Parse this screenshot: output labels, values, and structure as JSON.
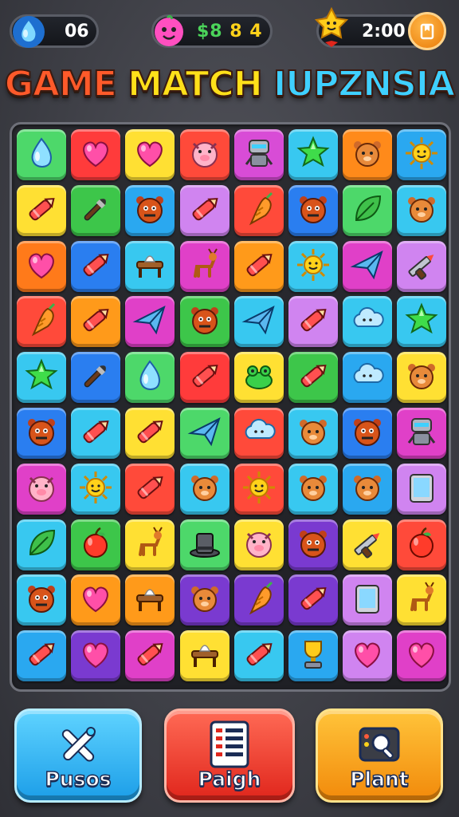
{
  "hud": {
    "lives": "06",
    "coins_a": "$8",
    "coins_b": "8 4",
    "timer": "2:00",
    "icons": {
      "lives": "water-drop-icon",
      "coins": "pink-face-icon",
      "timer_char": "star-character-icon",
      "timer_button": "book-icon"
    }
  },
  "title": {
    "part1": "GAME ",
    "part2": "MATCH ",
    "part3": "IUPZNSIA"
  },
  "board": {
    "rows": [
      [
        [
          "#4dd86a",
          "drop"
        ],
        [
          "#ff3b3b",
          "heart"
        ],
        [
          "#ffe033",
          "heart"
        ],
        [
          "#ff4a3a",
          "pig"
        ],
        [
          "#d84cd6",
          "robot"
        ],
        [
          "#38c8f0",
          "star"
        ],
        [
          "#ff8a1a",
          "bear"
        ],
        [
          "#2aa8f0",
          "sun"
        ]
      ],
      [
        [
          "#ffe033",
          "crayon"
        ],
        [
          "#3dc64a",
          "brush"
        ],
        [
          "#2aa8f0",
          "monster"
        ],
        [
          "#d084f0",
          "crayon"
        ],
        [
          "#ff4a3a",
          "carrot"
        ],
        [
          "#2a7ef0",
          "monster"
        ],
        [
          "#4dd86a",
          "leaf"
        ],
        [
          "#38c8f0",
          "bear"
        ]
      ],
      [
        [
          "#ff7a1a",
          "heart"
        ],
        [
          "#2a7ef0",
          "crayon"
        ],
        [
          "#38c8f0",
          "table"
        ],
        [
          "#e040c8",
          "deer"
        ],
        [
          "#ff9a1a",
          "crayon"
        ],
        [
          "#38c8f0",
          "sun"
        ],
        [
          "#e040c8",
          "plane"
        ],
        [
          "#d084f0",
          "gun"
        ]
      ],
      [
        [
          "#ff4a3a",
          "carrot"
        ],
        [
          "#ff9a1a",
          "crayon"
        ],
        [
          "#e040c8",
          "plane"
        ],
        [
          "#3dc64a",
          "monster"
        ],
        [
          "#38c8f0",
          "plane"
        ],
        [
          "#d084f0",
          "crayon"
        ],
        [
          "#38c8f0",
          "cloud"
        ],
        [
          "#38c8f0",
          "star"
        ]
      ],
      [
        [
          "#38c8f0",
          "star"
        ],
        [
          "#2a7ef0",
          "brush"
        ],
        [
          "#4dd86a",
          "drop"
        ],
        [
          "#ff3b3b",
          "crayon"
        ],
        [
          "#ffe033",
          "frog"
        ],
        [
          "#3dc64a",
          "crayon"
        ],
        [
          "#2aa8f0",
          "cloud"
        ],
        [
          "#ffe033",
          "bear"
        ]
      ],
      [
        [
          "#2a7ef0",
          "monster"
        ],
        [
          "#38c8f0",
          "crayon"
        ],
        [
          "#ffe033",
          "crayon"
        ],
        [
          "#4dd86a",
          "plane"
        ],
        [
          "#ff4a3a",
          "cloud"
        ],
        [
          "#38c8f0",
          "bear"
        ],
        [
          "#2a7ef0",
          "monster"
        ],
        [
          "#e040c8",
          "robot"
        ]
      ],
      [
        [
          "#e040c8",
          "pig"
        ],
        [
          "#38c8f0",
          "sun"
        ],
        [
          "#ff4a3a",
          "crayon"
        ],
        [
          "#38c8f0",
          "bear"
        ],
        [
          "#ff4a3a",
          "sun"
        ],
        [
          "#38c8f0",
          "bear"
        ],
        [
          "#2aa8f0",
          "bear"
        ],
        [
          "#d084f0",
          "tablet"
        ]
      ],
      [
        [
          "#38c8f0",
          "leaf"
        ],
        [
          "#3dc64a",
          "apple"
        ],
        [
          "#ffe033",
          "deer"
        ],
        [
          "#4dd86a",
          "hat"
        ],
        [
          "#ffe033",
          "pig"
        ],
        [
          "#7a3ad0",
          "monster"
        ],
        [
          "#ffe033",
          "gun"
        ],
        [
          "#ff4a3a",
          "apple"
        ]
      ],
      [
        [
          "#38c8f0",
          "monster"
        ],
        [
          "#ff9a1a",
          "heart"
        ],
        [
          "#ff9a1a",
          "table"
        ],
        [
          "#7a3ad0",
          "bear"
        ],
        [
          "#7a3ad0",
          "carrot"
        ],
        [
          "#7a3ad0",
          "crayon"
        ],
        [
          "#d084f0",
          "tablet"
        ],
        [
          "#ffe033",
          "deer"
        ]
      ],
      [
        [
          "#2aa8f0",
          "crayon"
        ],
        [
          "#7a3ad0",
          "heart"
        ],
        [
          "#e040c8",
          "crayon"
        ],
        [
          "#ffe033",
          "table"
        ],
        [
          "#38c8f0",
          "crayon"
        ],
        [
          "#2aa8f0",
          "trophy"
        ],
        [
          "#d084f0",
          "heart"
        ],
        [
          "#e040c8",
          "heart"
        ]
      ]
    ]
  },
  "buttons": [
    {
      "label": "Pusos",
      "icon": "cross-tools-icon",
      "color": "#1c9ee8"
    },
    {
      "label": "Paigh",
      "icon": "list-icon",
      "color": "#e0261c"
    },
    {
      "label": "Plant",
      "icon": "search-box-icon",
      "color": "#f28a0b"
    }
  ]
}
